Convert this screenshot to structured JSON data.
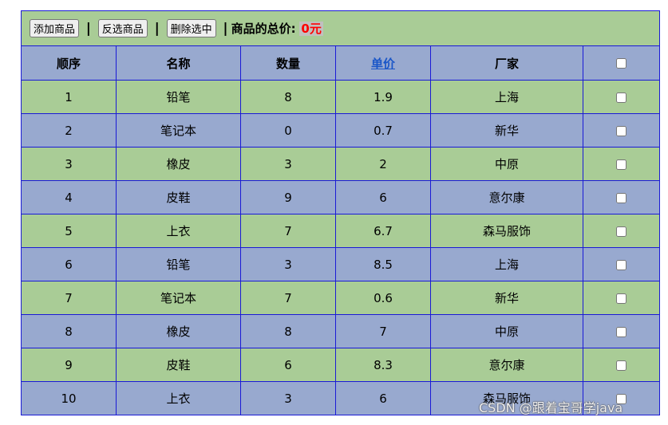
{
  "toolbar": {
    "add_label": "添加商品",
    "invert_label": "反选商品",
    "delete_label": "删除选中",
    "separator": "|",
    "total_label": "商品的总价:",
    "total_value": "0元"
  },
  "table": {
    "headers": [
      "顺序",
      "名称",
      "数量",
      "单价",
      "厂家"
    ],
    "rows": [
      [
        "1",
        "铅笔",
        "8",
        "1.9",
        "上海"
      ],
      [
        "2",
        "笔记本",
        "0",
        "0.7",
        "新华"
      ],
      [
        "3",
        "橡皮",
        "3",
        "2",
        "中原"
      ],
      [
        "4",
        "皮鞋",
        "9",
        "6",
        "意尔康"
      ],
      [
        "5",
        "上衣",
        "7",
        "6.7",
        "森马服饰"
      ],
      [
        "6",
        "铅笔",
        "3",
        "8.5",
        "上海"
      ],
      [
        "7",
        "笔记本",
        "7",
        "0.6",
        "新华"
      ],
      [
        "8",
        "橡皮",
        "8",
        "7",
        "中原"
      ],
      [
        "9",
        "皮鞋",
        "6",
        "8.3",
        "意尔康"
      ],
      [
        "10",
        "上衣",
        "3",
        "6",
        "森马服饰"
      ]
    ]
  },
  "watermark": "CSDN @跟着宝哥学java",
  "colors": {
    "green_row": "#a9cc96",
    "blue_row": "#98a9cf",
    "border": "#1a1ad6",
    "total": "#ff0000"
  }
}
